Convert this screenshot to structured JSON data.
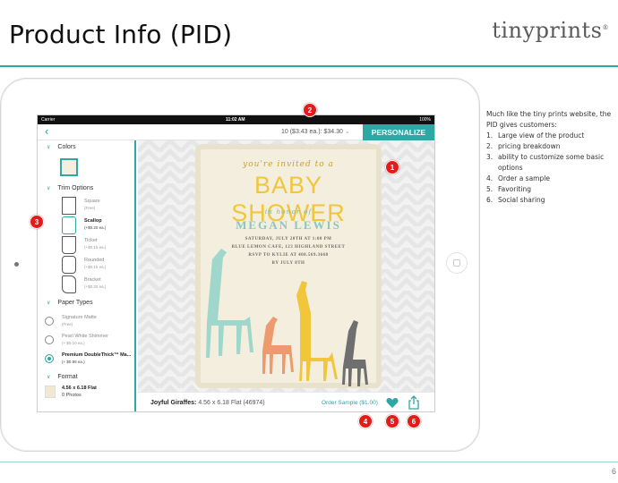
{
  "slide": {
    "title": "Product Info (PID)",
    "brand": "tinyprints",
    "page_number": "6"
  },
  "description": {
    "intro": "Much like the tiny prints website, the PID gives customers:",
    "items": [
      {
        "num": "1.",
        "text": "Large view of the product"
      },
      {
        "num": "2.",
        "text": "pricing breakdown"
      },
      {
        "num": "3.",
        "text": "ability to customize some basic options"
      },
      {
        "num": "4.",
        "text": "Order a sample"
      },
      {
        "num": "5.",
        "text": "Favoriting"
      },
      {
        "num": "6.",
        "text": "Social sharing"
      }
    ]
  },
  "status_bar": {
    "carrier": "Carrier",
    "time": "11:02 AM",
    "battery": "100%"
  },
  "nav": {
    "back": "‹",
    "price": "10 ($3.43 ea.): $34.30",
    "price_chevron": "⌄",
    "personalize": "PERSONALIZE"
  },
  "sidebar": {
    "colors_label": "Colors",
    "trim_label": "Trim Options",
    "trims": [
      {
        "name": "Square",
        "price": "(Free)",
        "selected": false
      },
      {
        "name": "Scallop",
        "price": "(+$0.20 ea.)",
        "selected": true
      },
      {
        "name": "Ticket",
        "price": "(+$0.15 ea.)",
        "selected": false
      },
      {
        "name": "Rounded",
        "price": "(+$0.15 ea.)",
        "selected": false
      },
      {
        "name": "Bracket",
        "price": "(+$0.20 ea.)",
        "selected": false
      }
    ],
    "paper_label": "Paper Types",
    "papers": [
      {
        "name": "Signature Matte",
        "price": "(Free)",
        "selected": false
      },
      {
        "name": "Pearl White Shimmer",
        "price": "(+ $0.10 ea.)",
        "selected": false
      },
      {
        "name": "Premium DoubleThick™ Ma...",
        "price": "(+ $0.99 ea.)",
        "selected": true
      }
    ],
    "format_label": "Format",
    "format": {
      "size": "4.56 x 6.18 Flat",
      "photos": "0 Photos"
    }
  },
  "card": {
    "invited": "you're invited to a",
    "title": "BABY SHOWER",
    "honor": "in honor of",
    "name": "MEGAN LEWIS",
    "details": [
      "SATURDAY, JULY 20TH AT 1:00 PM",
      "BLUE LEMON CAFE, 123 HIGHLAND STREET",
      "RSVP TO KYLIE AT 408.569.3668",
      "BY JULY 8TH"
    ]
  },
  "bottom": {
    "product_name": "Joyful Giraffes:",
    "product_detail": "4.56 x 6.18 Flat (46974)",
    "order_sample": "Order Sample ($1.00)"
  },
  "callouts": [
    "1",
    "2",
    "3",
    "4",
    "5",
    "6"
  ],
  "colors": {
    "accent": "#2ea7a5",
    "callout": "#e21b1b",
    "card_bg": "#f3eedd"
  }
}
